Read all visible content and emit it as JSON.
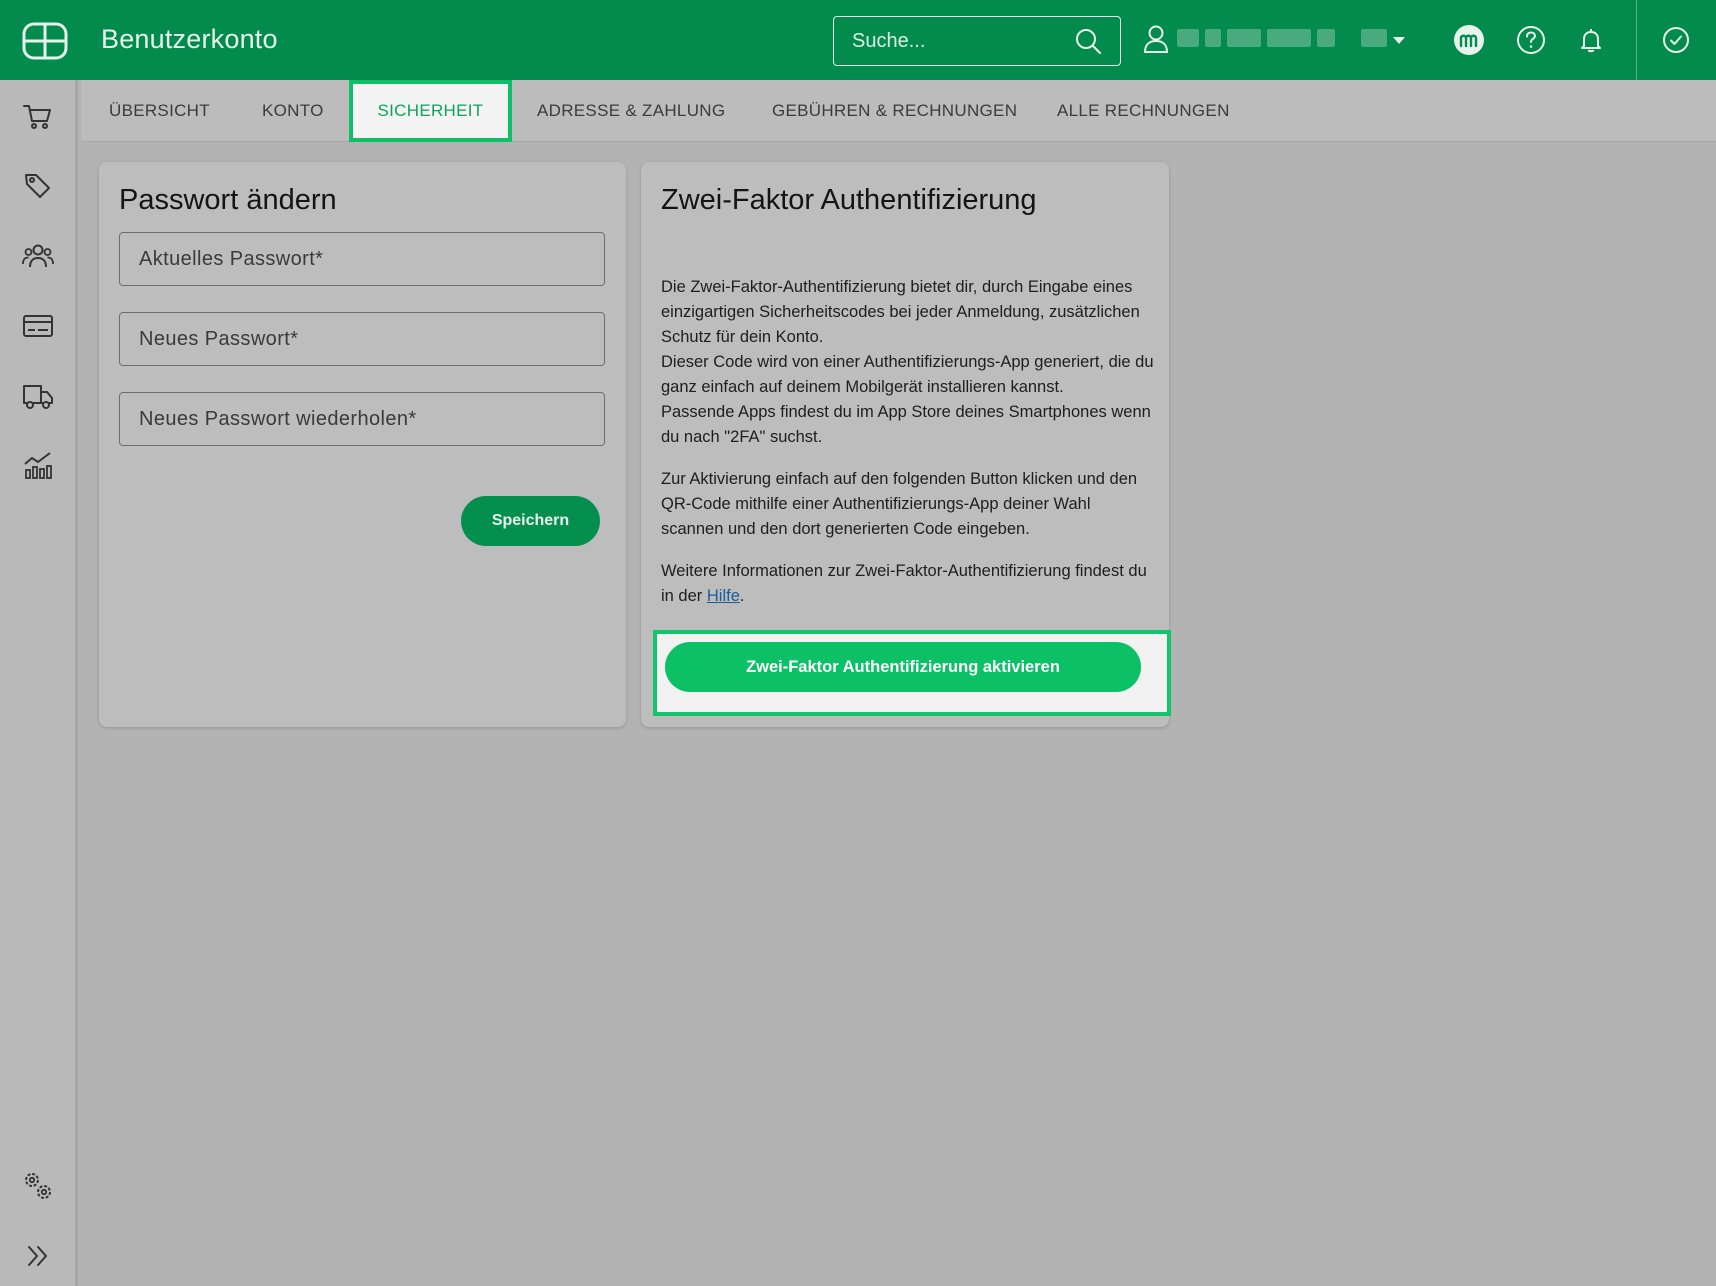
{
  "header": {
    "app_title": "Benutzerkonto",
    "search_placeholder": "Suche...",
    "icons": [
      "logo-icon",
      "search-icon",
      "user-icon",
      "caret-down-icon",
      "marketplace-icon",
      "help-icon",
      "bell-icon",
      "check-circle-icon"
    ]
  },
  "sidebar": {
    "items": [
      "cart-icon",
      "tags-icon",
      "users-icon",
      "credit-card-icon",
      "truck-icon",
      "analytics-icon"
    ],
    "bottom": [
      "settings-icon",
      "expand-icon"
    ]
  },
  "tabs": [
    {
      "label": "ÜBERSICHT"
    },
    {
      "label": "KONTO"
    },
    {
      "label": "SICHERHEIT",
      "active": true
    },
    {
      "label": "ADRESSE & ZAHLUNG"
    },
    {
      "label": "GEBÜHREN & RECHNUNGEN"
    },
    {
      "label": "ALLE RECHNUNGEN"
    }
  ],
  "password_card": {
    "title": "Passwort ändern",
    "current_placeholder": "Aktuelles Passwort*",
    "new_placeholder": "Neues Passwort*",
    "repeat_placeholder": "Neues Passwort wiederholen*",
    "save_label": "Speichern"
  },
  "twofa_card": {
    "title": "Zwei-Faktor Authentifizierung",
    "para1_line1": "Die Zwei-Faktor-Authentifizierung bietet dir, durch Eingabe eines einzigartigen Sicherheitscodes bei jeder Anmeldung, zusätzlichen Schutz für dein Konto.",
    "para1_line2": "Dieser Code wird von einer Authentifizierungs-App generiert, die du ganz einfach auf deinem Mobilgerät installieren kannst.",
    "para1_line3": "Passende Apps findest du im App Store deines Smartphones wenn du nach \"2FA\" suchst.",
    "para2": "Zur Aktivierung einfach auf den folgenden Button klicken und den QR-Code mithilfe einer Authentifizierungs-App deiner Wahl scannen und den dort generierten Code eingeben.",
    "para3_prefix": "Weitere Informationen zur Zwei-Faktor-Authentifizierung findest du in der ",
    "para3_link": "Hilfe",
    "para3_suffix": ".",
    "activate_label": "Zwei-Faktor Authentifizierung aktivieren"
  },
  "colors": {
    "header_green": "#038a4d",
    "accent_green": "#0cc165",
    "highlight_green": "#12c46b"
  }
}
